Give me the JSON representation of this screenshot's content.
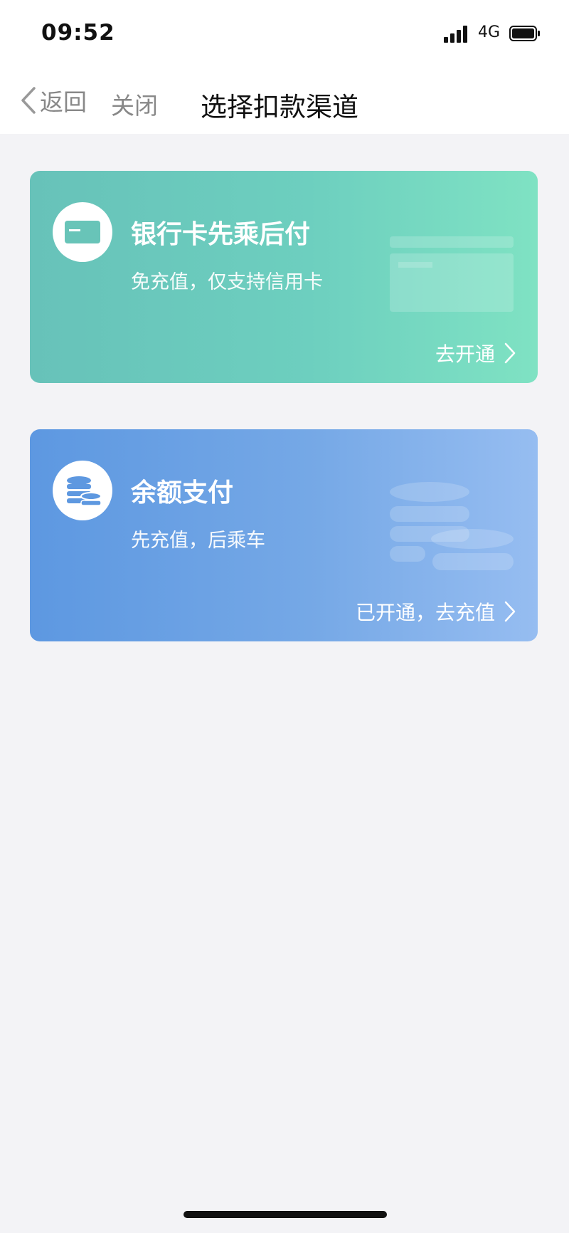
{
  "status_bar": {
    "time": "09:52",
    "network": "4G",
    "icons": [
      "signal-icon",
      "battery-icon"
    ]
  },
  "nav": {
    "back_label": "返回",
    "close_label": "关闭",
    "title": "选择扣款渠道",
    "icons": [
      "chevron-left-icon"
    ]
  },
  "cards": [
    {
      "title": "银行卡先乘后付",
      "subtitle": "免充值，仅支持信用卡",
      "action": "去开通",
      "icon": "credit-card-icon",
      "gradient": [
        "#67c2b9",
        "#7fe2c3"
      ]
    },
    {
      "title": "余额支付",
      "subtitle": "先充值，后乘车",
      "action": "已开通，去充值",
      "icon": "coins-icon",
      "gradient": [
        "#5d98e1",
        "#96bdf1"
      ]
    }
  ],
  "colors": {
    "background": "#f3f3f6",
    "nav_text_muted": "#888888",
    "title_text": "#111111"
  }
}
